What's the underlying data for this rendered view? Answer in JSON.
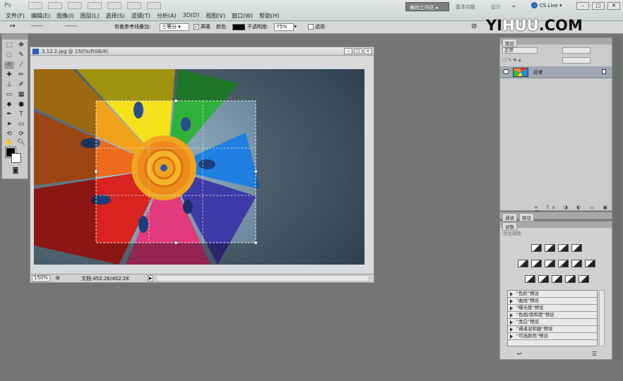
{
  "app": {
    "logo": "Ps",
    "menus": [
      "文件(F)",
      "编辑(E)",
      "图像(I)",
      "图层(L)",
      "选择(S)",
      "滤镜(T)",
      "分析(A)",
      "3D(D)",
      "视图(V)",
      "窗口(W)",
      "帮助(H)"
    ],
    "workspaces": [
      "美的工作区 ▸",
      "基本功能",
      "设计",
      "»"
    ],
    "cs_live": "CS Live ▾",
    "watermark_a": "YI",
    "watermark_b": "HUU",
    "watermark_c": ".COM"
  },
  "options": {
    "crop_label": "剪裁参考线叠加:",
    "crop_value": "三等分",
    "shield_label": "屏蔽",
    "color_label": "颜色:",
    "opacity_label": "不透明度:",
    "opacity_value": "75%",
    "perspective_label": "透视"
  },
  "document": {
    "title": "3.12.2.jpg @ 150%(RGB/8)",
    "zoom": "150%",
    "doc_info": "文档:452.2K/452.2K"
  },
  "layers_panel": {
    "tab": "图层",
    "blend_mode": "正常",
    "layer_name": "背景"
  },
  "channels_tabs": [
    "通道",
    "路径"
  ],
  "adjustments": {
    "tab": "调整",
    "subtitle": "添加调整",
    "presets": [
      "\"色阶\"预设",
      "\"曲线\"预设",
      "\"曝光度\"预设",
      "\"色相/饱和度\"预设",
      "\"黑白\"预设",
      "\"通道混和器\"预设",
      "\"可选颜色\"预设"
    ]
  },
  "colors": {
    "workspace_bg": "#747674",
    "panel_bg": "#c9cbcc",
    "accent_blue": "#2f5fb8"
  }
}
